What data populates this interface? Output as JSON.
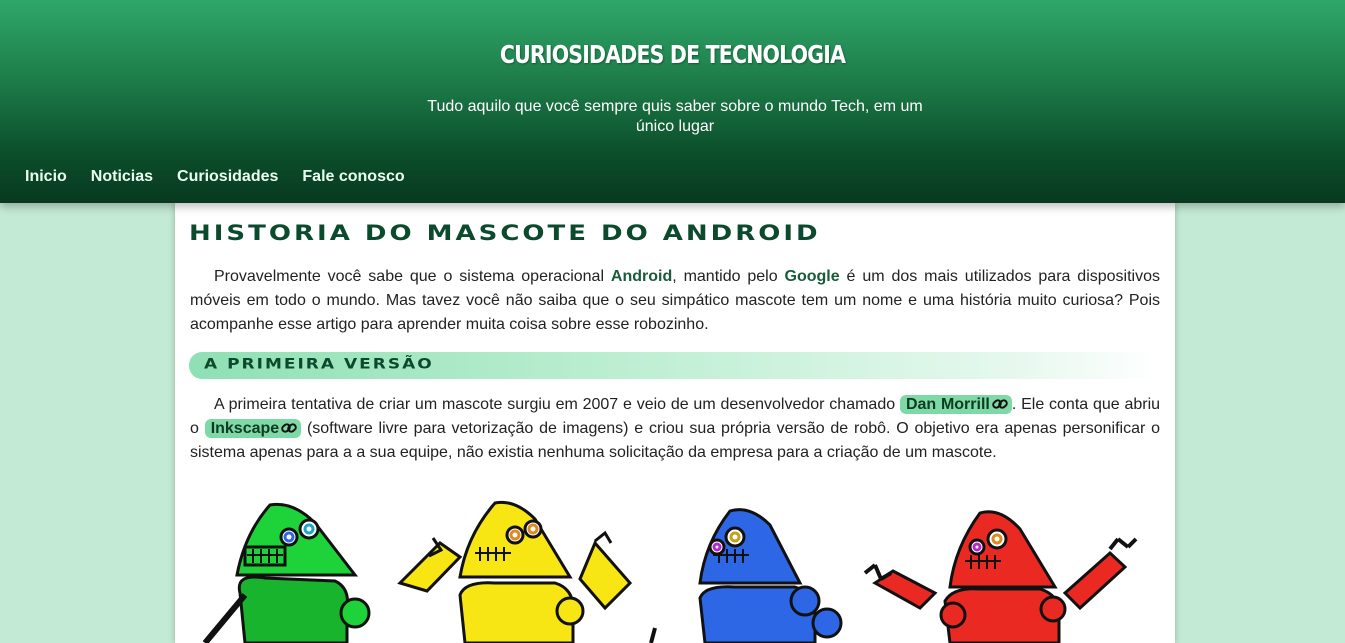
{
  "header": {
    "title": "CURIOSIDADES DE TECNOLOGIA",
    "subtitle": "Tudo aquilo que você sempre quis saber sobre o mundo Tech, em um único lugar"
  },
  "nav": [
    {
      "label": "Inicio"
    },
    {
      "label": "Noticias"
    },
    {
      "label": "Curiosidades"
    },
    {
      "label": "Fale conosco"
    }
  ],
  "article": {
    "title": "Historia do Mascote do Android",
    "intro": {
      "p1": "Provavelmente você sabe que o sistema operacional ",
      "android": "Android",
      "p2": ", mantido pelo ",
      "google": "Google",
      "p3": " é um dos mais utilizados para dispositivos móveis em todo o mundo. Mas tavez você não saiba que o seu simpático mascote tem um nome e uma história muito curiosa? Pois acompanhe esse artigo para aprender muita coisa sobre esse robozinho."
    },
    "section1": {
      "heading": "A primeira versão",
      "p1": "A primeira tentativa de criar um mascote surgiu em 2007 e veio de um desenvolvedor chamado ",
      "link1": "Dan Morrill",
      "p2": ". Ele conta que abriu o ",
      "link2": "Inkscape",
      "p3": " (software livre para vetorização de imagens) e criou sua própria versão de robô. O objetivo era apenas personificar o sistema apenas para a a sua equipe, não existia nenhuma solicitação da empresa para a criação de um mascote."
    }
  },
  "colors": {
    "header_top": "#2fa76a",
    "header_bottom": "#07391f",
    "page_bg": "#c3ead4",
    "title_color": "#0b4a2c",
    "link_badge": "#7fd9a6",
    "robot_green": "#1ed23a",
    "robot_yellow": "#f7e514",
    "robot_blue": "#2e67e6",
    "robot_red": "#ea2a22"
  },
  "icons": {
    "link": "paperclip-link-icon"
  }
}
